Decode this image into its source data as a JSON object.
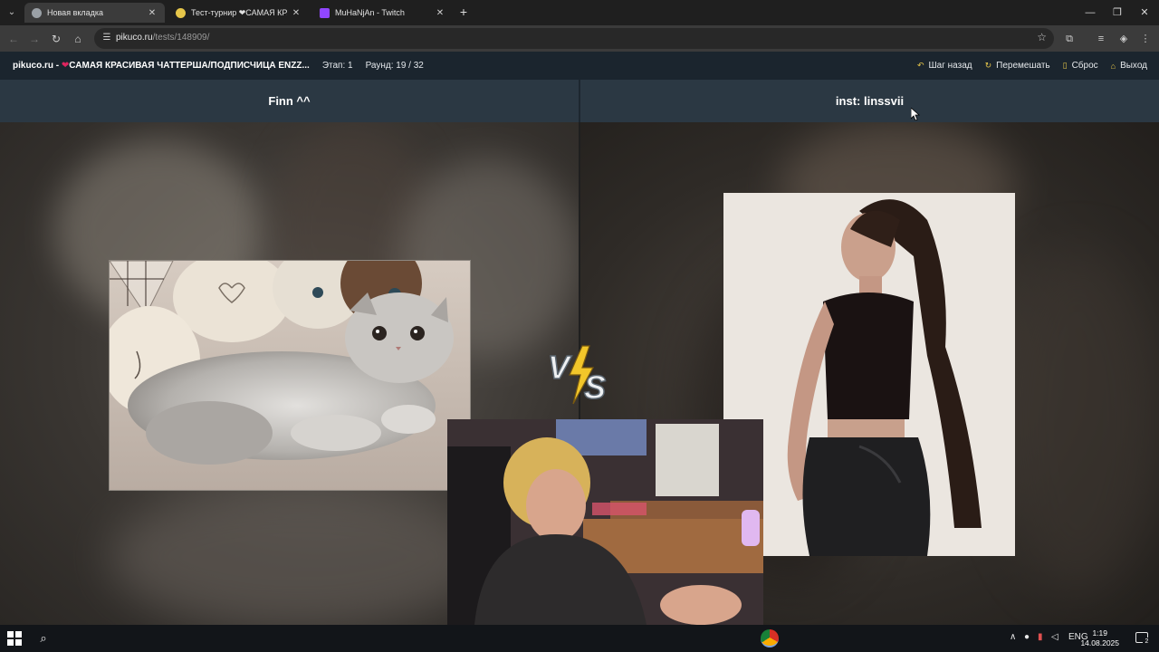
{
  "browser": {
    "tabs": [
      {
        "title": "Новая вкладка",
        "active": true,
        "favicon_color": "#9aa0a6"
      },
      {
        "title": "Тест-турнир ❤САМАЯ КРАСИВАЯ",
        "active": false,
        "favicon_color": "#e6c64a"
      },
      {
        "title": "MuHaNjAn - Twitch",
        "active": false,
        "favicon_color": "#9146ff"
      }
    ],
    "url": {
      "host": "pikuco.ru",
      "path": "/tests/148909/"
    }
  },
  "site": {
    "title_prefix": "pikuco.ru - ",
    "title_heart": "❤",
    "title_text": "САМАЯ КРАСИВАЯ ЧАТТЕРША/ПОДПИСЧИЦА ENZZ...",
    "stage": "Этап: 1",
    "round": "Раунд: 19 / 32",
    "actions": {
      "back": "Шаг назад",
      "shuffle": "Перемешать",
      "reset": "Сброс",
      "exit": "Выход"
    },
    "accent_color": "#e6c64a"
  },
  "contest": {
    "left_name": "Finn ^^",
    "right_name": "inst: linssvii",
    "vs_text": "VS"
  },
  "taskbar": {
    "lang": "ENG",
    "time": "1:19",
    "date": "14.08.2025",
    "notifications": "2"
  }
}
